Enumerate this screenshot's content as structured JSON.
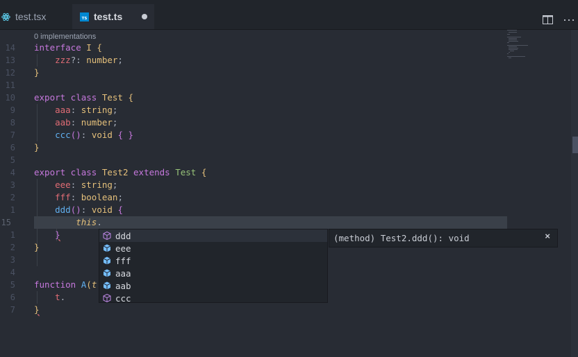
{
  "tabs": [
    {
      "label": "test.tsx",
      "icon": "react-icon",
      "active": false
    },
    {
      "label": "test.ts",
      "icon": "typescript-icon",
      "active": true,
      "dirty": true
    }
  ],
  "toolbar": {
    "split_icon": "split-editor-icon",
    "more": "···"
  },
  "codelens": "0 implementations",
  "gutter": [
    "14",
    "13",
    "12",
    "11",
    "10",
    "9",
    "8",
    "7",
    "6",
    "5",
    "4",
    "3",
    "2",
    "1",
    "15",
    "1",
    "2",
    "3",
    "4",
    "5",
    "6",
    "7"
  ],
  "suggest": {
    "items": [
      {
        "label": "ddd",
        "kind": "method-icon"
      },
      {
        "label": "eee",
        "kind": "field-icon"
      },
      {
        "label": "fff",
        "kind": "field-icon"
      },
      {
        "label": "aaa",
        "kind": "field-icon"
      },
      {
        "label": "aab",
        "kind": "field-icon"
      },
      {
        "label": "ccc",
        "kind": "method-icon"
      }
    ],
    "detail": "(method) Test2.ddd(): void",
    "close": "×"
  },
  "colors": {
    "keyword": "#c678dd",
    "type": "#e5c07b",
    "property": "#e06c75",
    "function": "#61afef",
    "class2": "#98c379"
  }
}
